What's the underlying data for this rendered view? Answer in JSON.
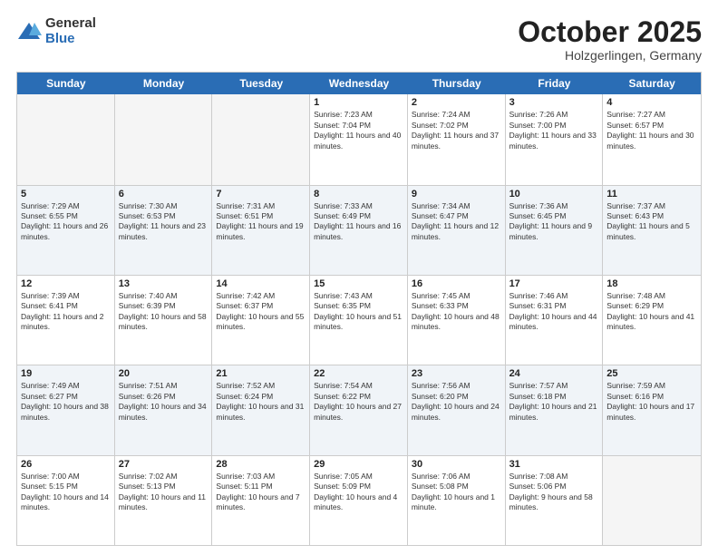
{
  "header": {
    "logo": {
      "general": "General",
      "blue": "Blue"
    },
    "title": "October 2025",
    "location": "Holzgerlingen, Germany"
  },
  "dayHeaders": [
    "Sunday",
    "Monday",
    "Tuesday",
    "Wednesday",
    "Thursday",
    "Friday",
    "Saturday"
  ],
  "weeks": [
    [
      {
        "date": "",
        "sunrise": "",
        "sunset": "",
        "daylight": "",
        "empty": true
      },
      {
        "date": "",
        "sunrise": "",
        "sunset": "",
        "daylight": "",
        "empty": true
      },
      {
        "date": "",
        "sunrise": "",
        "sunset": "",
        "daylight": "",
        "empty": true
      },
      {
        "date": "1",
        "sunrise": "Sunrise: 7:23 AM",
        "sunset": "Sunset: 7:04 PM",
        "daylight": "Daylight: 11 hours and 40 minutes.",
        "empty": false
      },
      {
        "date": "2",
        "sunrise": "Sunrise: 7:24 AM",
        "sunset": "Sunset: 7:02 PM",
        "daylight": "Daylight: 11 hours and 37 minutes.",
        "empty": false
      },
      {
        "date": "3",
        "sunrise": "Sunrise: 7:26 AM",
        "sunset": "Sunset: 7:00 PM",
        "daylight": "Daylight: 11 hours and 33 minutes.",
        "empty": false
      },
      {
        "date": "4",
        "sunrise": "Sunrise: 7:27 AM",
        "sunset": "Sunset: 6:57 PM",
        "daylight": "Daylight: 11 hours and 30 minutes.",
        "empty": false
      }
    ],
    [
      {
        "date": "5",
        "sunrise": "Sunrise: 7:29 AM",
        "sunset": "Sunset: 6:55 PM",
        "daylight": "Daylight: 11 hours and 26 minutes.",
        "empty": false
      },
      {
        "date": "6",
        "sunrise": "Sunrise: 7:30 AM",
        "sunset": "Sunset: 6:53 PM",
        "daylight": "Daylight: 11 hours and 23 minutes.",
        "empty": false
      },
      {
        "date": "7",
        "sunrise": "Sunrise: 7:31 AM",
        "sunset": "Sunset: 6:51 PM",
        "daylight": "Daylight: 11 hours and 19 minutes.",
        "empty": false
      },
      {
        "date": "8",
        "sunrise": "Sunrise: 7:33 AM",
        "sunset": "Sunset: 6:49 PM",
        "daylight": "Daylight: 11 hours and 16 minutes.",
        "empty": false
      },
      {
        "date": "9",
        "sunrise": "Sunrise: 7:34 AM",
        "sunset": "Sunset: 6:47 PM",
        "daylight": "Daylight: 11 hours and 12 minutes.",
        "empty": false
      },
      {
        "date": "10",
        "sunrise": "Sunrise: 7:36 AM",
        "sunset": "Sunset: 6:45 PM",
        "daylight": "Daylight: 11 hours and 9 minutes.",
        "empty": false
      },
      {
        "date": "11",
        "sunrise": "Sunrise: 7:37 AM",
        "sunset": "Sunset: 6:43 PM",
        "daylight": "Daylight: 11 hours and 5 minutes.",
        "empty": false
      }
    ],
    [
      {
        "date": "12",
        "sunrise": "Sunrise: 7:39 AM",
        "sunset": "Sunset: 6:41 PM",
        "daylight": "Daylight: 11 hours and 2 minutes.",
        "empty": false
      },
      {
        "date": "13",
        "sunrise": "Sunrise: 7:40 AM",
        "sunset": "Sunset: 6:39 PM",
        "daylight": "Daylight: 10 hours and 58 minutes.",
        "empty": false
      },
      {
        "date": "14",
        "sunrise": "Sunrise: 7:42 AM",
        "sunset": "Sunset: 6:37 PM",
        "daylight": "Daylight: 10 hours and 55 minutes.",
        "empty": false
      },
      {
        "date": "15",
        "sunrise": "Sunrise: 7:43 AM",
        "sunset": "Sunset: 6:35 PM",
        "daylight": "Daylight: 10 hours and 51 minutes.",
        "empty": false
      },
      {
        "date": "16",
        "sunrise": "Sunrise: 7:45 AM",
        "sunset": "Sunset: 6:33 PM",
        "daylight": "Daylight: 10 hours and 48 minutes.",
        "empty": false
      },
      {
        "date": "17",
        "sunrise": "Sunrise: 7:46 AM",
        "sunset": "Sunset: 6:31 PM",
        "daylight": "Daylight: 10 hours and 44 minutes.",
        "empty": false
      },
      {
        "date": "18",
        "sunrise": "Sunrise: 7:48 AM",
        "sunset": "Sunset: 6:29 PM",
        "daylight": "Daylight: 10 hours and 41 minutes.",
        "empty": false
      }
    ],
    [
      {
        "date": "19",
        "sunrise": "Sunrise: 7:49 AM",
        "sunset": "Sunset: 6:27 PM",
        "daylight": "Daylight: 10 hours and 38 minutes.",
        "empty": false
      },
      {
        "date": "20",
        "sunrise": "Sunrise: 7:51 AM",
        "sunset": "Sunset: 6:26 PM",
        "daylight": "Daylight: 10 hours and 34 minutes.",
        "empty": false
      },
      {
        "date": "21",
        "sunrise": "Sunrise: 7:52 AM",
        "sunset": "Sunset: 6:24 PM",
        "daylight": "Daylight: 10 hours and 31 minutes.",
        "empty": false
      },
      {
        "date": "22",
        "sunrise": "Sunrise: 7:54 AM",
        "sunset": "Sunset: 6:22 PM",
        "daylight": "Daylight: 10 hours and 27 minutes.",
        "empty": false
      },
      {
        "date": "23",
        "sunrise": "Sunrise: 7:56 AM",
        "sunset": "Sunset: 6:20 PM",
        "daylight": "Daylight: 10 hours and 24 minutes.",
        "empty": false
      },
      {
        "date": "24",
        "sunrise": "Sunrise: 7:57 AM",
        "sunset": "Sunset: 6:18 PM",
        "daylight": "Daylight: 10 hours and 21 minutes.",
        "empty": false
      },
      {
        "date": "25",
        "sunrise": "Sunrise: 7:59 AM",
        "sunset": "Sunset: 6:16 PM",
        "daylight": "Daylight: 10 hours and 17 minutes.",
        "empty": false
      }
    ],
    [
      {
        "date": "26",
        "sunrise": "Sunrise: 7:00 AM",
        "sunset": "Sunset: 5:15 PM",
        "daylight": "Daylight: 10 hours and 14 minutes.",
        "empty": false
      },
      {
        "date": "27",
        "sunrise": "Sunrise: 7:02 AM",
        "sunset": "Sunset: 5:13 PM",
        "daylight": "Daylight: 10 hours and 11 minutes.",
        "empty": false
      },
      {
        "date": "28",
        "sunrise": "Sunrise: 7:03 AM",
        "sunset": "Sunset: 5:11 PM",
        "daylight": "Daylight: 10 hours and 7 minutes.",
        "empty": false
      },
      {
        "date": "29",
        "sunrise": "Sunrise: 7:05 AM",
        "sunset": "Sunset: 5:09 PM",
        "daylight": "Daylight: 10 hours and 4 minutes.",
        "empty": false
      },
      {
        "date": "30",
        "sunrise": "Sunrise: 7:06 AM",
        "sunset": "Sunset: 5:08 PM",
        "daylight": "Daylight: 10 hours and 1 minute.",
        "empty": false
      },
      {
        "date": "31",
        "sunrise": "Sunrise: 7:08 AM",
        "sunset": "Sunset: 5:06 PM",
        "daylight": "Daylight: 9 hours and 58 minutes.",
        "empty": false
      },
      {
        "date": "",
        "sunrise": "",
        "sunset": "",
        "daylight": "",
        "empty": true
      }
    ]
  ]
}
